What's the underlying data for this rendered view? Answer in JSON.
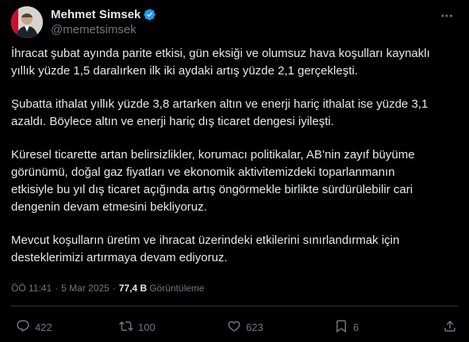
{
  "author": {
    "name": "Mehmet Simsek",
    "handle": "@memetsimsek"
  },
  "tweet": {
    "paragraphs": [
      "İhracat şubat ayında parite etkisi, gün eksiği ve olumsuz hava koşulları kaynaklı\nyıllık yüzde 1,5 daralırken ilk iki aydaki artış yüzde 2,1 gerçekleşti.",
      "Şubatta ithalat yıllık yüzde 3,8 artarken altın ve enerji hariç ithalat ise yüzde 3,1\nazaldı. Böylece altın ve enerji hariç dış ticaret dengesi iyileşti.",
      "Küresel ticarette artan belirsizlikler, korumacı politikalar, AB’nin zayıf büyüme\ngörünümü, doğal gaz fiyatları ve ekonomik aktivitemizdeki toparlanmanın\netkisiyle bu yıl dış ticaret açığında artış öngörmekle birlikte sürdürülebilir cari\ndengenin devam etmesini bekliyoruz.",
      "Mevcut koşulların üretim ve ihracat üzerindeki etkilerini sınırlandırmak için\ndesteklerimizi artırmaya devam ediyoruz."
    ]
  },
  "meta": {
    "time": "ÖÖ 11:41",
    "separator": "·",
    "date": "5 Mar 2025",
    "views": "77,4 B",
    "views_label": "Görüntüleme"
  },
  "actions": {
    "replies": "422",
    "reposts": "100",
    "likes": "623",
    "bookmarks": "6"
  },
  "icons": {
    "verified": "verified-badge-icon",
    "more": "more-dots-icon",
    "reply": "reply-icon",
    "repost": "repost-icon",
    "like": "heart-icon",
    "bookmark": "bookmark-icon",
    "share": "share-icon"
  },
  "colors": {
    "background": "#000000",
    "text": "#e7e9ea",
    "secondary": "#71767b",
    "verified": "#1d9bf0",
    "divider": "#2f3336"
  }
}
